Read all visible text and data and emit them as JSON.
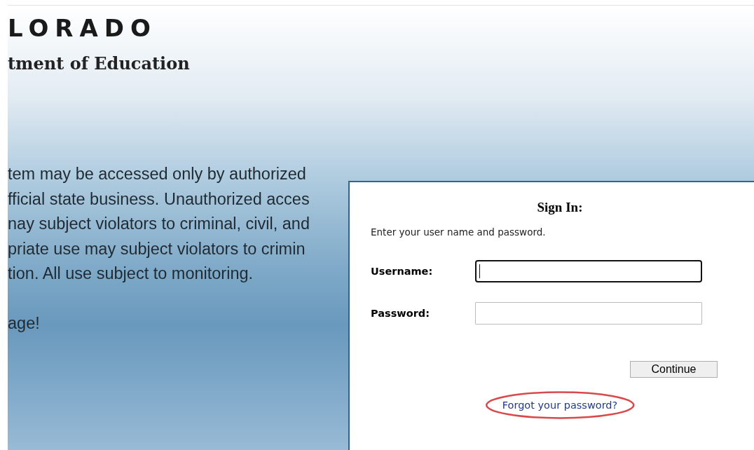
{
  "header": {
    "logo": "LORADO",
    "subtitle": "tment of Education"
  },
  "notice": {
    "lines": [
      "tem may be accessed only by authorized",
      "fficial state business. Unauthorized acces",
      "nay subject violators to criminal, civil, and",
      "priate use may subject violators to crimin",
      "tion. All use subject to monitoring."
    ],
    "footer": "age!"
  },
  "signin": {
    "title": "Sign In:",
    "instructions": "Enter your user name and password.",
    "fields": [
      {
        "label": "Username:",
        "focused": true
      },
      {
        "label": "Password:",
        "focused": false
      }
    ],
    "button": "Continue",
    "link": {
      "label": "Forgot your password?",
      "highlighted": true
    }
  }
}
